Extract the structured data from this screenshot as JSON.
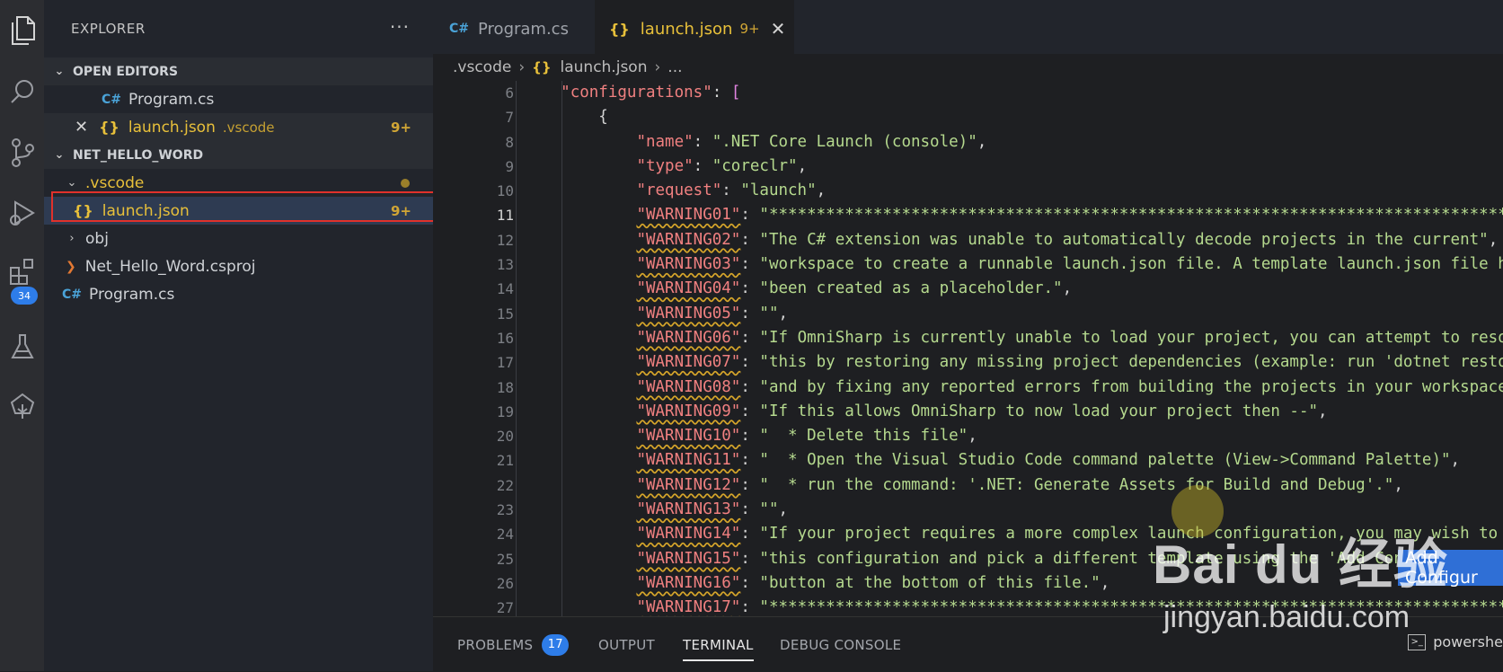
{
  "activity_bar": {
    "extensions_badge": "34"
  },
  "explorer": {
    "title": "EXPLORER",
    "more": "···",
    "open_editors": {
      "title": "OPEN EDITORS",
      "items": [
        {
          "icon": "C#",
          "name": "Program.cs"
        },
        {
          "close": "✕",
          "icon": "{}",
          "name": "launch.json",
          "folder": ".vscode",
          "count": "9+"
        }
      ]
    },
    "project": {
      "title": "NET_HELLO_WORD",
      "items": [
        {
          "name": ".vscode"
        },
        {
          "icon": "{}",
          "name": "launch.json",
          "count": "9+"
        },
        {
          "name": "obj"
        },
        {
          "name": "Net_Hello_Word.csproj"
        },
        {
          "icon": "C#",
          "name": "Program.cs"
        }
      ]
    }
  },
  "tabs": [
    {
      "icon": "C#",
      "label": "Program.cs"
    },
    {
      "icon": "{}",
      "label": "launch.json",
      "count": "9+",
      "close": "✕"
    }
  ],
  "breadcrumb": {
    "folder": ".vscode",
    "file": "launch.json",
    "more": "..."
  },
  "editor": {
    "line_numbers": [
      "6",
      "7",
      "8",
      "9",
      "10",
      "11",
      "12",
      "13",
      "14",
      "15",
      "16",
      "17",
      "18",
      "19",
      "20",
      "21",
      "22",
      "23",
      "24",
      "25",
      "26",
      "27"
    ],
    "current_line": "11",
    "lines": [
      {
        "key": "\"configurations\"",
        "val": "["
      },
      {
        "open": "{"
      },
      {
        "key": "\"name\"",
        "val": "\".NET Core Launch (console)\"",
        "end": ","
      },
      {
        "key": "\"type\"",
        "val": "\"coreclr\"",
        "end": ","
      },
      {
        "key": "\"request\"",
        "val": "\"launch\"",
        "end": ","
      },
      {
        "key": "\"WARNING01\"",
        "val": "\"*********************************************************************************\"",
        "end": ","
      },
      {
        "key": "\"WARNING02\"",
        "val": "\"The C# extension was unable to automatically decode projects in the current\"",
        "end": ","
      },
      {
        "key": "\"WARNING03\"",
        "val": "\"workspace to create a runnable launch.json file. A template launch.json file has\"",
        "end": ","
      },
      {
        "key": "\"WARNING04\"",
        "val": "\"been created as a placeholder.\"",
        "end": ","
      },
      {
        "key": "\"WARNING05\"",
        "val": "\"\"",
        "end": ","
      },
      {
        "key": "\"WARNING06\"",
        "val": "\"If OmniSharp is currently unable to load your project, you can attempt to resolve\"",
        "end": ","
      },
      {
        "key": "\"WARNING07\"",
        "val": "\"this by restoring any missing project dependencies (example: run 'dotnet restore')\"",
        "end": ","
      },
      {
        "key": "\"WARNING08\"",
        "val": "\"and by fixing any reported errors from building the projects in your workspace.\"",
        "end": ","
      },
      {
        "key": "\"WARNING09\"",
        "val": "\"If this allows OmniSharp to now load your project then --\"",
        "end": ","
      },
      {
        "key": "\"WARNING10\"",
        "val": "\"  * Delete this file\"",
        "end": ","
      },
      {
        "key": "\"WARNING11\"",
        "val": "\"  * Open the Visual Studio Code command palette (View->Command Palette)\"",
        "end": ","
      },
      {
        "key": "\"WARNING12\"",
        "val": "\"  * run the command: '.NET: Generate Assets for Build and Debug'.\"",
        "end": ","
      },
      {
        "key": "\"WARNING13\"",
        "val": "\"\"",
        "end": ","
      },
      {
        "key": "\"WARNING14\"",
        "val": "\"If your project requires a more complex launch configuration, you may wish to delete\"",
        "end": ","
      },
      {
        "key": "\"WARNING15\"",
        "val": "\"this configuration and pick a different template using the 'Add Configuration...'\"",
        "end": ","
      },
      {
        "key": "\"WARNING16\"",
        "val": "\"button at the bottom of this file.\"",
        "end": ","
      },
      {
        "key": "\"WARNING17\"",
        "val": "\"*********************************************************************************\"",
        "end": ","
      }
    ],
    "add_config_button": "Add Configur"
  },
  "panel": {
    "tabs": [
      {
        "label": "PROBLEMS",
        "badge": "17"
      },
      {
        "label": "OUTPUT"
      },
      {
        "label": "TERMINAL"
      },
      {
        "label": "DEBUG CONSOLE"
      }
    ],
    "shell": "powershe"
  },
  "watermark": {
    "brand": "Bai du 经验",
    "url": "jingyan.baidu.com"
  }
}
